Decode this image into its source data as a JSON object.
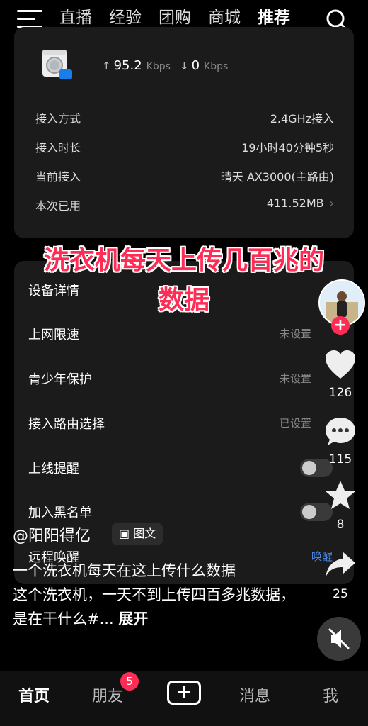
{
  "nav": {
    "tabs": [
      "直播",
      "经验",
      "团购",
      "商城",
      "推荐"
    ],
    "active_tab": "推荐"
  },
  "device": {
    "upload_speed": "95.2",
    "upload_unit": "Kbps",
    "download_speed": "0",
    "download_unit": "Kbps"
  },
  "info": [
    {
      "label": "接入方式",
      "value": "2.4GHz接入"
    },
    {
      "label": "接入时长",
      "value": "19小时40分钟5秒"
    },
    {
      "label": "当前接入",
      "value": "晴天 AX3000(主路由)"
    },
    {
      "label": "本次已用",
      "value": "411.52MB"
    }
  ],
  "settings": [
    {
      "label": "设备详情",
      "status": ""
    },
    {
      "label": "上网限速",
      "status": "未设置"
    },
    {
      "label": "青少年保护",
      "status": "未设置"
    },
    {
      "label": "接入路由选择",
      "status": "已设置"
    },
    {
      "label": "上线提醒",
      "status": ""
    },
    {
      "label": "加入黑名单",
      "status": ""
    },
    {
      "label": "远程唤醒",
      "status": "唤醒"
    }
  ],
  "overlay": {
    "line1": "洗衣机每天上传几百兆的",
    "line2": "数据"
  },
  "rail": {
    "likes": "126",
    "comments": "115",
    "favorites": "8",
    "shares": "25"
  },
  "post": {
    "author": "@阳阳得亿",
    "type_badge": "图文",
    "caption_title": "一个洗衣机每天在这上传什么数据",
    "caption_body": "这个洗衣机，一天不到上传四百多兆数据，是在干什么#...",
    "expand": "展开"
  },
  "bottom_nav": {
    "home": "首页",
    "friends": "朋友",
    "friends_badge": "5",
    "messages": "消息",
    "me": "我"
  },
  "colors": {
    "accent": "#ff2d55",
    "link": "#4a8cf0",
    "card": "#1b1b1b"
  }
}
